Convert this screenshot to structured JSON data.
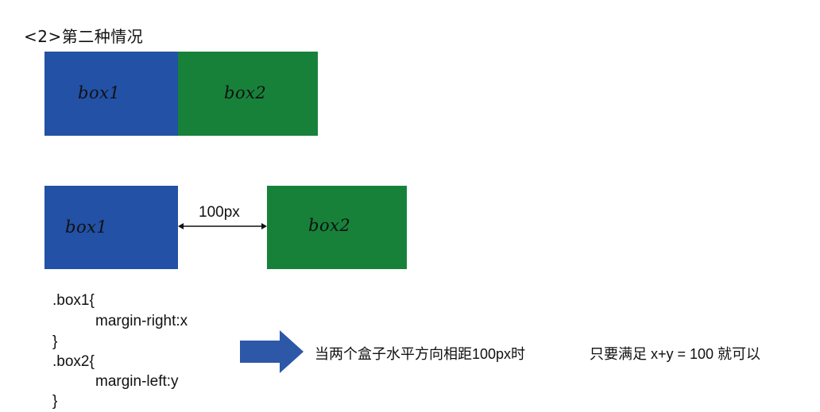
{
  "heading": "<2>第二种情况",
  "row1": {
    "box1_label": "box1",
    "box2_label": "box2"
  },
  "row2": {
    "box1_label": "box1",
    "box2_label": "box2",
    "gap_label": "100px"
  },
  "code": {
    "line1": ".box1{",
    "line2": "margin-right:x",
    "line3": "}",
    "line4": ".box2{",
    "line5": "margin-left:y",
    "line6": "}"
  },
  "description": {
    "left": "当两个盒子水平方向相距100px时",
    "right": "只要满足 x+y = 100 就可以"
  },
  "colors": {
    "box1": "#2251a6",
    "box2": "#17813a",
    "arrow": "#2d58a8"
  }
}
